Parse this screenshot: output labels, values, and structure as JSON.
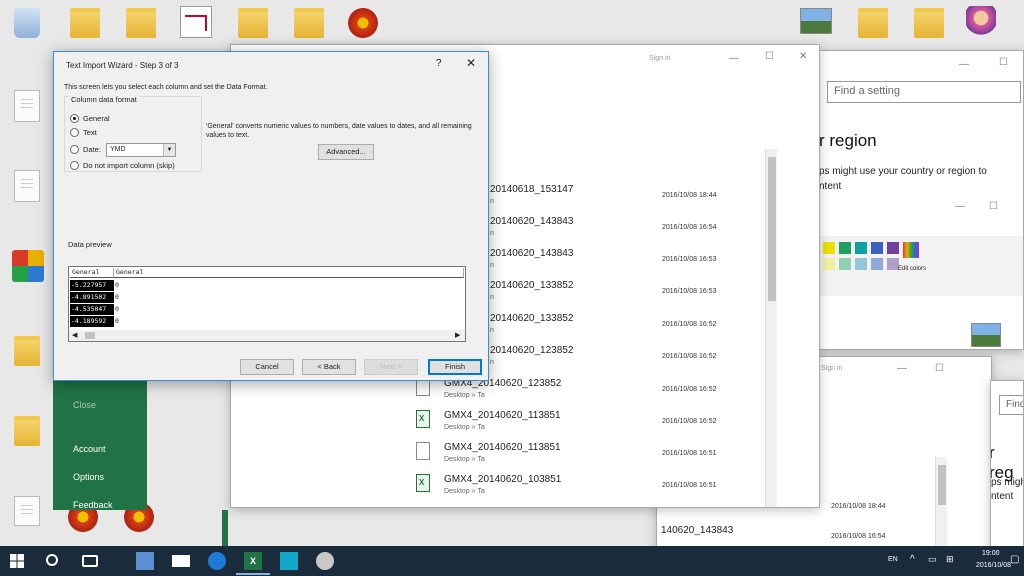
{
  "desktop": {
    "icon_labels": [
      "",
      "",
      "",
      "",
      "",
      "",
      "",
      "",
      "",
      "",
      "",
      "",
      "",
      "",
      "",
      ""
    ]
  },
  "dialog": {
    "title": "Text Import Wizard - Step 3 of 3",
    "help": "?",
    "close": "✕",
    "description": "This screen lets you select each column and set the Data Format.",
    "column_format_label": "Column data format",
    "radio_general": "General",
    "radio_text": "Text",
    "radio_date": "Date:",
    "date_value": "YMD",
    "radio_skip": "Do not import column (skip)",
    "general_note": "'General' converts numeric values to numbers, date values to dates, and all remaining values to text.",
    "advanced_label": "Advanced...",
    "preview_label": "Data preview",
    "preview_headers": [
      "General",
      "General"
    ],
    "preview_rows": [
      [
        "-5.227957",
        "0"
      ],
      [
        "-4.891502",
        "0"
      ],
      [
        "-4.535047",
        "0"
      ],
      [
        "-4.189592",
        "0"
      ]
    ],
    "cancel_label": "Cancel",
    "back_label": "< Back",
    "next_label": "Next >",
    "finish_label": "Finish"
  },
  "explorer": {
    "signin": "Sign in",
    "rows": [
      {
        "name": "20140618_153147",
        "sub": "n",
        "date": "2016/10/08 18:44"
      },
      {
        "name": "20140620_143843",
        "sub": "n",
        "date": "2016/10/08 16:54"
      },
      {
        "name": "20140620_143843",
        "sub": "n",
        "date": "2016/10/08 16:53"
      },
      {
        "name": "20140620_133852",
        "sub": "n",
        "date": "2016/10/08 16:53"
      },
      {
        "name": "20140620_133852",
        "sub": "n",
        "date": "2016/10/08 16:52"
      },
      {
        "name": "20140620_123852",
        "sub": "n",
        "date": "2016/10/08 16:52"
      },
      {
        "name": "GMX4_20140620_123852",
        "sub": "Desktop » Ta",
        "date": "2016/10/08 16:52"
      },
      {
        "name": "GMX4_20140620_113851",
        "sub": "Desktop » Ta",
        "date": "2016/10/08 16:52"
      },
      {
        "name": "GMX4_20140620_113851",
        "sub": "Desktop » Ta",
        "date": "2016/10/08 16:51"
      },
      {
        "name": "GMX4_20140620_103851",
        "sub": "Desktop » Ta",
        "date": "2016/10/08 16:51"
      }
    ]
  },
  "excel_backstage": {
    "items": [
      "Close",
      "Account",
      "Options",
      "Feedback"
    ]
  },
  "settings": {
    "search_placeholder": "Find a setting",
    "heading_fragment": "r region",
    "text_line1": "ps might use your country or region to",
    "text_line2": "ntent",
    "edit_colors": "Edit colors",
    "heading_fragment2": "r reg",
    "text2_line1": "ps migh",
    "text2_line2": "ntent",
    "find2": "Find"
  },
  "back_explorer": {
    "signin": "Sign in",
    "row1_name": "140620_143843",
    "date1": "2016/10/08 18:44",
    "date2": "2016/10/08 16:54"
  },
  "taskbar": {
    "lang": "EN",
    "time": "19:00",
    "date": "2016/10/08"
  },
  "colors": {
    "taskbar": "#1a2b3c",
    "excel_green": "#217346",
    "dialog_border": "#3a8fd0"
  }
}
